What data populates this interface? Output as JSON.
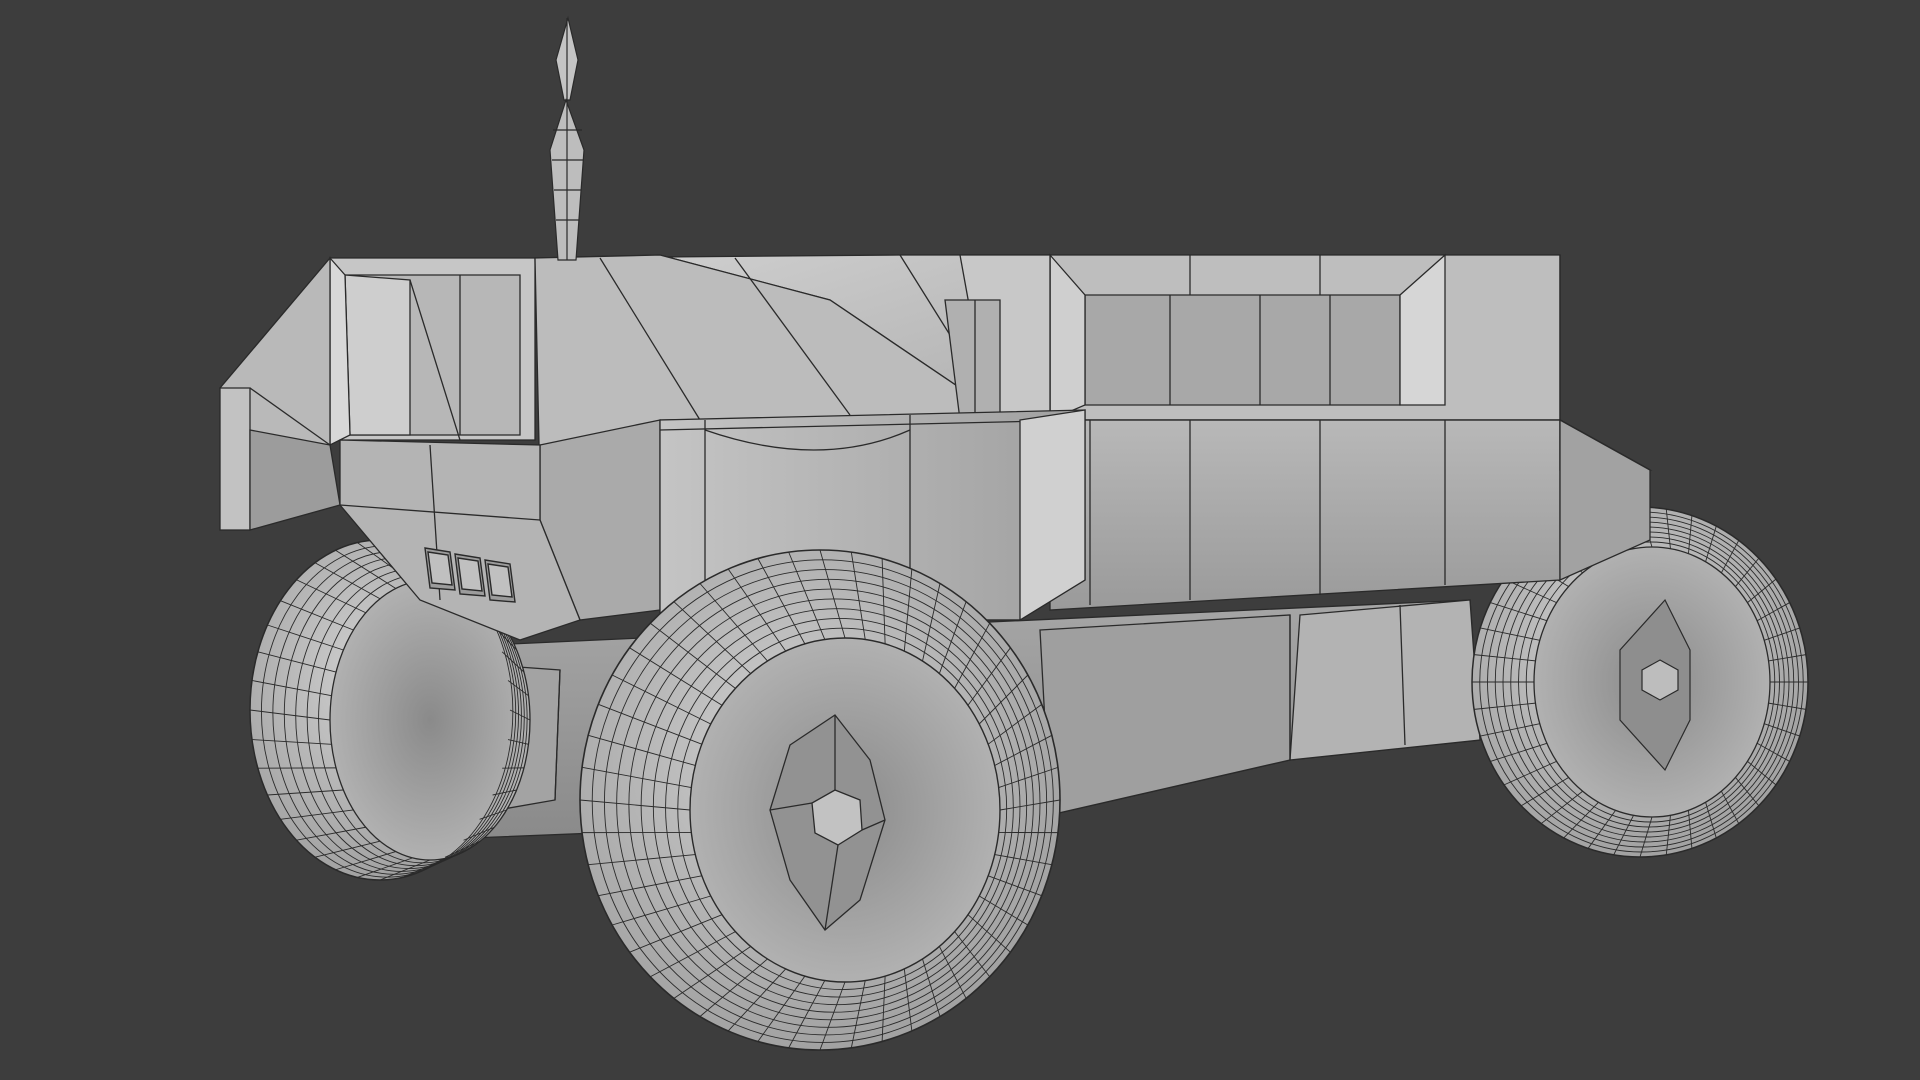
{
  "app": {
    "name": "3D viewport",
    "view_mode": "solid-shading-wireframe-overlay"
  },
  "scene": {
    "object": "rover-vehicle",
    "parts": [
      "antenna",
      "cabin-body",
      "front-bumper",
      "headlight-cluster",
      "side-panel",
      "undercarriage",
      "front-left-wheel",
      "front-right-wheel",
      "rear-wheel"
    ],
    "headlight_count": 3,
    "wheel_count": 3
  },
  "colors": {
    "background": "#3d3d3d",
    "surface_light": "#c9c9c9",
    "surface_mid": "#a9a9a9",
    "surface_dark": "#858585",
    "wire": "#2a2a2a",
    "tire": "#bdbdbd",
    "hub": "#8e8e8e"
  }
}
